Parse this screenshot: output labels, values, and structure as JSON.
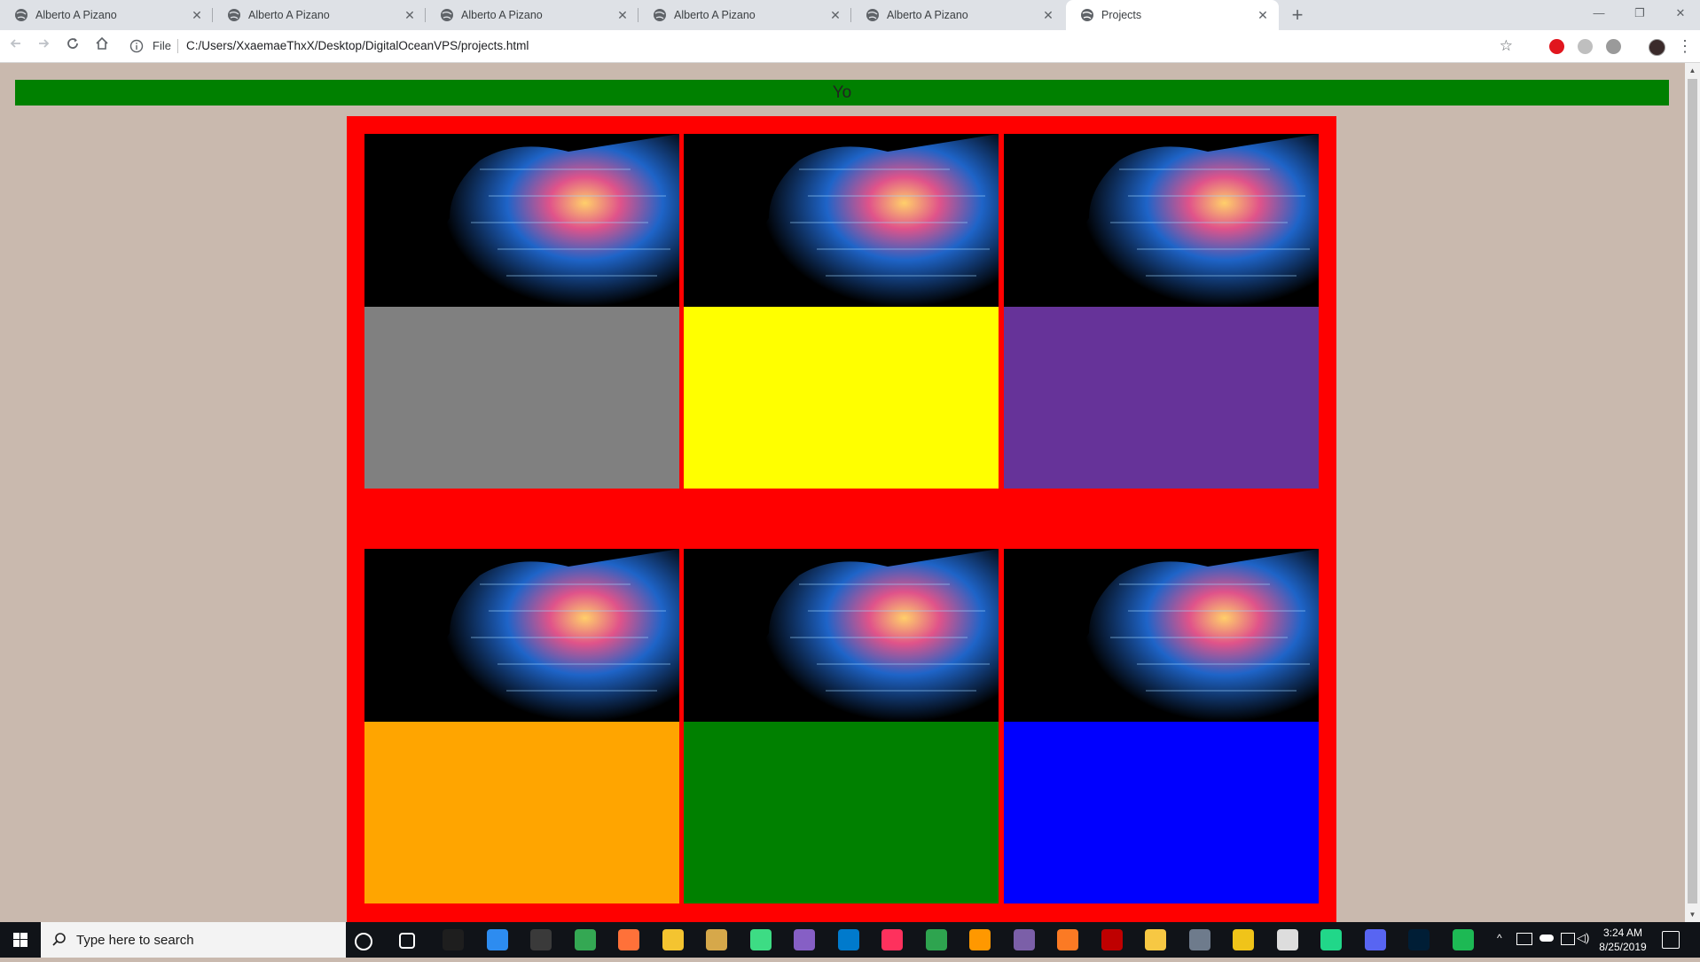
{
  "browser": {
    "tabs": [
      {
        "title": "Alberto A Pizano",
        "active": false
      },
      {
        "title": "Alberto A Pizano",
        "active": false
      },
      {
        "title": "Alberto A Pizano",
        "active": false
      },
      {
        "title": "Alberto A Pizano",
        "active": false
      },
      {
        "title": "Alberto A Pizano",
        "active": false
      },
      {
        "title": "Projects",
        "active": true
      }
    ],
    "new_tab": "+",
    "window_controls": {
      "minimize": "—",
      "restore": "❐",
      "close": "✕"
    },
    "address": {
      "scheme_label": "File",
      "url": "C:/Users/XxaemaeThxX/Desktop/DigitalOceanVPS/projects.html"
    },
    "icons": {
      "back": "back-arrow-icon",
      "forward": "forward-arrow-icon",
      "reload": "reload-icon",
      "home": "home-icon",
      "info": "info-icon",
      "star": "star-icon",
      "menu": "kebab-menu-icon"
    }
  },
  "page": {
    "header_text": "Yo",
    "colors": {
      "background": "#c9b9ae",
      "header": "#008000",
      "grid_border": "#ff0000"
    },
    "cards": [
      {
        "color": "#808080"
      },
      {
        "color": "#ffff00"
      },
      {
        "color": "#663399"
      },
      {
        "color": "#ffa500"
      },
      {
        "color": "#008000"
      },
      {
        "color": "#0000ff"
      }
    ]
  },
  "taskbar": {
    "search_placeholder": "Type here to search",
    "time": "3:24 AM",
    "date": "8/25/2019",
    "apps": [
      "cortana-icon",
      "task-view-icon",
      "terminal-icon",
      "sourcetree-icon",
      "window-icon",
      "chrome-icon",
      "firefox-icon",
      "file-explorer-icon",
      "paint-brush-icon",
      "android-studio-icon",
      "visual-studio-icon",
      "vscode-icon",
      "intellij-icon",
      "gitkraken-icon",
      "sublime-text-icon",
      "obs-icon",
      "xampp-icon",
      "filezilla-icon",
      "unity-package-icon",
      "vpn-icon",
      "notes-icon",
      "unity-icon",
      "pycharm-icon",
      "discord-icon",
      "photoshop-icon",
      "spotify-icon"
    ],
    "app_colors": [
      "#101318",
      "#101318",
      "#1e1e1e",
      "#2d8cf0",
      "#3a3a3a",
      "#34a853",
      "#ff7139",
      "#f4c430",
      "#d6a84a",
      "#3ddc84",
      "#865fc5",
      "#007acc",
      "#fe315d",
      "#2ea44f",
      "#ff9800",
      "#7b5fa8",
      "#fb7a24",
      "#bf0000",
      "#f7c843",
      "#6e7b8c",
      "#f0c419",
      "#dddddd",
      "#21d789",
      "#5865f2",
      "#001e36",
      "#1db954"
    ]
  }
}
